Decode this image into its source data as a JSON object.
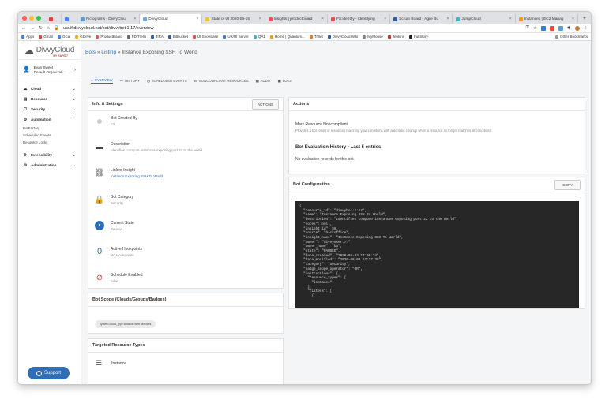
{
  "browser": {
    "tabs": [
      {
        "label": "Pictograms - DivvyClou",
        "color": "#4aa3df"
      },
      {
        "label": "DivvyCloud",
        "color": "#6aa9e0",
        "active": true
      },
      {
        "label": "State of UI 2020-09-15",
        "color": "#f4c242"
      },
      {
        "label": "Insights | productboard",
        "color": "#e8545c"
      },
      {
        "label": "FS:identify - Identifying",
        "color": "#e64c4c"
      },
      {
        "label": "Scrum Board - Agile Bo",
        "color": "#2d5fa8"
      },
      {
        "label": "JumpCloud",
        "color": "#3fb5c4"
      },
      {
        "label": "Instances | EC2 Manag",
        "color": "#f29b1d"
      }
    ],
    "url": "usuif.divvycloud.net/bot/divvybot:1:17/overview",
    "bookmarks": [
      "Apps",
      "Gmail",
      "GCal",
      "GDrive",
      "ProductBoard",
      "FD Trello",
      "JIRA",
      "BitBucket",
      "UI Showcase",
      "UX/UI Server",
      "QA1",
      "Home | Quantum...",
      "Trillet",
      "DivvyCloud Wiki",
      "MyMoose",
      "Jenkins",
      "FullStory"
    ],
    "other_bookmarks": "Other Bookmarks"
  },
  "sidebar": {
    "logo": "DivvyCloud",
    "logo_sub": "BY RAPID7",
    "user_name": "Evan Sweet",
    "user_org": "Default Organizati...",
    "items": [
      {
        "label": "Cloud",
        "icon": "cloud-icon"
      },
      {
        "label": "Resource",
        "icon": "resource-icon"
      },
      {
        "label": "Security",
        "icon": "shield-icon"
      },
      {
        "label": "Automation",
        "icon": "robot-icon",
        "expanded": true
      },
      {
        "label": "Extensibility",
        "icon": "puzzle-icon"
      },
      {
        "label": "Administration",
        "icon": "gear-icon"
      }
    ],
    "subitems": [
      "BotFactory",
      "Scheduled Events",
      "Resource Locks"
    ],
    "support": "Support"
  },
  "breadcrumb": {
    "root": "Bots",
    "listing": "Listing",
    "sep": "»",
    "current": "Instance Exposing SSH To World"
  },
  "tabs": [
    "OVERVIEW",
    "HISTORY",
    "SCHEDULED EVENTS",
    "NONCOMPLIANT RESOURCES",
    "AUDIT",
    "LOGS"
  ],
  "info": {
    "title": "Info & Settings",
    "actions": "ACTIONS",
    "rows": [
      {
        "label": "Bot Created By",
        "value": "b3",
        "icon": "avatar-icon"
      },
      {
        "label": "Description",
        "value": "Identifies compute instances exposing port 22 to the world",
        "icon": "description-icon"
      },
      {
        "label": "Linked Insight",
        "value": "Instance Exposing SSH To World",
        "icon": "link-icon"
      },
      {
        "label": "Bot Category",
        "value": "Security",
        "icon": "lock-icon"
      },
      {
        "label": "Current State",
        "value": "Paused",
        "icon": "pause-icon"
      },
      {
        "label": "Active Hookpoints",
        "value": "No Hookpoints",
        "icon": "hookpoint-count-icon",
        "count": "0"
      },
      {
        "label": "Schedule Enabled",
        "value": "false",
        "icon": "schedule-off-icon"
      }
    ]
  },
  "scope": {
    "title": "Bot Scope (Clouds/Groups/Badges)",
    "chip": "system.cloud_type.amazon web services"
  },
  "targeted": {
    "title": "Targeted Resource Types",
    "item": "Instance"
  },
  "actions_panel": {
    "title": "Actions",
    "action_title": "Mark Resource Noncompliant",
    "action_desc": "Provides a bot report of resources matching your conditions with automatic cleanup when a resource no longer matches all conditions."
  },
  "history": {
    "title": "Bot Evaluation History - Last 5 entries",
    "empty": "No evaluation records for this bot."
  },
  "config": {
    "title": "Bot Configuration",
    "copy": "COPY",
    "json": "{\n  \"resource_id\": \"divvybot:1:17\",\n  \"name\": \"Instance Exposing SSH To World\",\n  \"description\": \"Identifies compute instances exposing port 22 to the world\",\n  \"notes\": null,\n  \"insight_id\": 58,\n  \"source\": \"backoffice\",\n  \"insight_name\": \"Instance Exposing SSH To World\",\n  \"owner\": \"divvyuser:7:\",\n  \"owner_name\": \"b3\",\n  \"state\": \"PAUSED\",\n  \"date_created\": \"2020-08-03 17:05:24\",\n  \"date_modified\": \"2020-08-03 17:17:38\",\n  \"category\": \"Security\",\n  \"badge_scope_operator\": \"OR\",\n  \"instructions\": {\n    \"resource_types\": [\n      \"instance\"\n    ],\n    \"filters\": [\n      {"
  }
}
